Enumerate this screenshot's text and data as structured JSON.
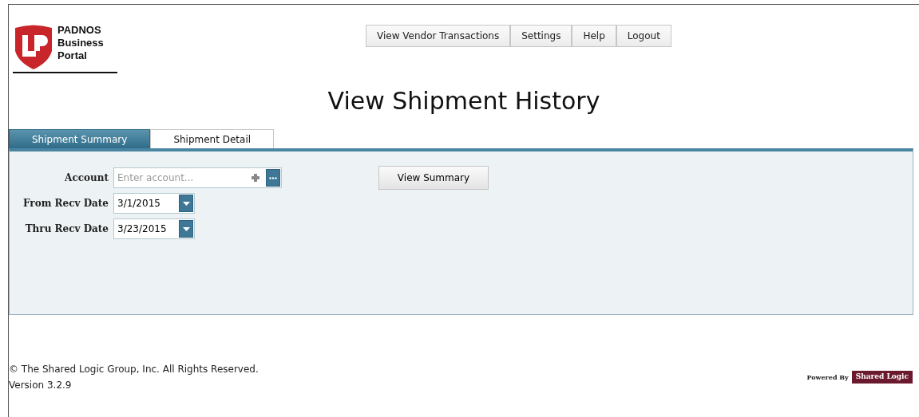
{
  "logo": {
    "lines": [
      "PADNOS",
      "Business",
      "Portal"
    ]
  },
  "nav": [
    {
      "label": "View Vendor Transactions"
    },
    {
      "label": "Settings"
    },
    {
      "label": "Help"
    },
    {
      "label": "Logout"
    }
  ],
  "title": "View Shipment History",
  "tabs": [
    {
      "label": "Shipment Summary",
      "selected": true
    },
    {
      "label": "Shipment Detail",
      "selected": false
    }
  ],
  "form": {
    "account": {
      "label": "Account",
      "placeholder": "Enter account..."
    },
    "dates": [
      {
        "label": "From Recv Date",
        "value": "3/1/2015"
      },
      {
        "label": "Thru Recv Date",
        "value": "3/23/2015"
      }
    ],
    "button": "View Summary"
  },
  "footer": {
    "copyright": "© The Shared Logic Group, Inc. All Rights Reserved.",
    "version": "Version 3.2.9",
    "powered_by": "Powered By",
    "brand": "Shared Logic"
  }
}
